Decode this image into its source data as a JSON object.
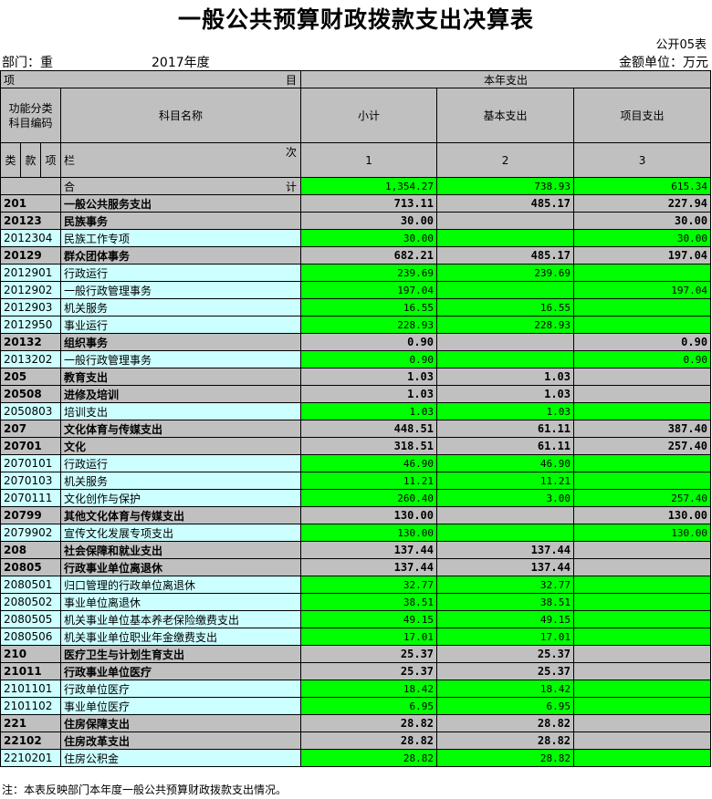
{
  "title": "一般公共预算财政拨款支出决算表",
  "form_code": "公开05表",
  "dept_label": "部门：重",
  "year_label": "2017年度",
  "unit_label": "金额单位：万元",
  "header": {
    "item": "项",
    "item_end": "目",
    "current_expense": "本年支出",
    "func_code": "功能分类\n科目编码",
    "subject_name": "科目名称",
    "subtotal": "小计",
    "basic": "基本支出",
    "project": "项目支出",
    "lei": "类",
    "kuan": "款",
    "xiang": "项",
    "lan": "栏",
    "ci": "次",
    "col1": "1",
    "col2": "2",
    "col3": "3",
    "he": "合",
    "ji": "计"
  },
  "total": {
    "subtotal": "1,354.27",
    "basic": "738.93",
    "project": "615.34"
  },
  "rows": [
    {
      "code": "201",
      "name": "一般公共服务支出",
      "subtotal": "713.11",
      "basic": "485.17",
      "project": "227.94",
      "level": 1
    },
    {
      "code": "20123",
      "name": "民族事务",
      "subtotal": "30.00",
      "basic": "",
      "project": "30.00",
      "level": 2
    },
    {
      "code": "2012304",
      "name": "民族工作专项",
      "subtotal": "30.00",
      "basic": "",
      "project": "30.00",
      "level": 3
    },
    {
      "code": "20129",
      "name": "群众团体事务",
      "subtotal": "682.21",
      "basic": "485.17",
      "project": "197.04",
      "level": 2
    },
    {
      "code": "2012901",
      "name": "行政运行",
      "subtotal": "239.69",
      "basic": "239.69",
      "project": "",
      "level": 3
    },
    {
      "code": "2012902",
      "name": "一般行政管理事务",
      "subtotal": "197.04",
      "basic": "",
      "project": "197.04",
      "level": 3
    },
    {
      "code": "2012903",
      "name": "机关服务",
      "subtotal": "16.55",
      "basic": "16.55",
      "project": "",
      "level": 3
    },
    {
      "code": "2012950",
      "name": "事业运行",
      "subtotal": "228.93",
      "basic": "228.93",
      "project": "",
      "level": 3
    },
    {
      "code": "20132",
      "name": "组织事务",
      "subtotal": "0.90",
      "basic": "",
      "project": "0.90",
      "level": 2
    },
    {
      "code": "2013202",
      "name": "一般行政管理事务",
      "subtotal": "0.90",
      "basic": "",
      "project": "0.90",
      "level": 3
    },
    {
      "code": "205",
      "name": "教育支出",
      "subtotal": "1.03",
      "basic": "1.03",
      "project": "",
      "level": 1
    },
    {
      "code": "20508",
      "name": "进修及培训",
      "subtotal": "1.03",
      "basic": "1.03",
      "project": "",
      "level": 2
    },
    {
      "code": "2050803",
      "name": "培训支出",
      "subtotal": "1.03",
      "basic": "1.03",
      "project": "",
      "level": 3
    },
    {
      "code": "207",
      "name": "文化体育与传媒支出",
      "subtotal": "448.51",
      "basic": "61.11",
      "project": "387.40",
      "level": 1
    },
    {
      "code": "20701",
      "name": "文化",
      "subtotal": "318.51",
      "basic": "61.11",
      "project": "257.40",
      "level": 2
    },
    {
      "code": "2070101",
      "name": "行政运行",
      "subtotal": "46.90",
      "basic": "46.90",
      "project": "",
      "level": 3
    },
    {
      "code": "2070103",
      "name": "机关服务",
      "subtotal": "11.21",
      "basic": "11.21",
      "project": "",
      "level": 3
    },
    {
      "code": "2070111",
      "name": "文化创作与保护",
      "subtotal": "260.40",
      "basic": "3.00",
      "project": "257.40",
      "level": 3
    },
    {
      "code": "20799",
      "name": "其他文化体育与传媒支出",
      "subtotal": "130.00",
      "basic": "",
      "project": "130.00",
      "level": 2
    },
    {
      "code": "2079902",
      "name": "宣传文化发展专项支出",
      "subtotal": "130.00",
      "basic": "",
      "project": "130.00",
      "level": 3
    },
    {
      "code": "208",
      "name": "社会保障和就业支出",
      "subtotal": "137.44",
      "basic": "137.44",
      "project": "",
      "level": 1
    },
    {
      "code": "20805",
      "name": "行政事业单位离退休",
      "subtotal": "137.44",
      "basic": "137.44",
      "project": "",
      "level": 2
    },
    {
      "code": "2080501",
      "name": "归口管理的行政单位离退休",
      "subtotal": "32.77",
      "basic": "32.77",
      "project": "",
      "level": 3
    },
    {
      "code": "2080502",
      "name": "事业单位离退休",
      "subtotal": "38.51",
      "basic": "38.51",
      "project": "",
      "level": 3
    },
    {
      "code": "2080505",
      "name": "机关事业单位基本养老保险缴费支出",
      "subtotal": "49.15",
      "basic": "49.15",
      "project": "",
      "level": 3
    },
    {
      "code": "2080506",
      "name": "机关事业单位职业年金缴费支出",
      "subtotal": "17.01",
      "basic": "17.01",
      "project": "",
      "level": 3
    },
    {
      "code": "210",
      "name": "医疗卫生与计划生育支出",
      "subtotal": "25.37",
      "basic": "25.37",
      "project": "",
      "level": 1
    },
    {
      "code": "21011",
      "name": "行政事业单位医疗",
      "subtotal": "25.37",
      "basic": "25.37",
      "project": "",
      "level": 2
    },
    {
      "code": "2101101",
      "name": "行政单位医疗",
      "subtotal": "18.42",
      "basic": "18.42",
      "project": "",
      "level": 3
    },
    {
      "code": "2101102",
      "name": "事业单位医疗",
      "subtotal": "6.95",
      "basic": "6.95",
      "project": "",
      "level": 3
    },
    {
      "code": "221",
      "name": "住房保障支出",
      "subtotal": "28.82",
      "basic": "28.82",
      "project": "",
      "level": 1
    },
    {
      "code": "22102",
      "name": "住房改革支出",
      "subtotal": "28.82",
      "basic": "28.82",
      "project": "",
      "level": 2
    },
    {
      "code": "2210201",
      "name": "住房公积金",
      "subtotal": "28.82",
      "basic": "28.82",
      "project": "",
      "level": 3
    }
  ],
  "note": "注：本表反映部门本年度一般公共预算财政拨款支出情况。"
}
